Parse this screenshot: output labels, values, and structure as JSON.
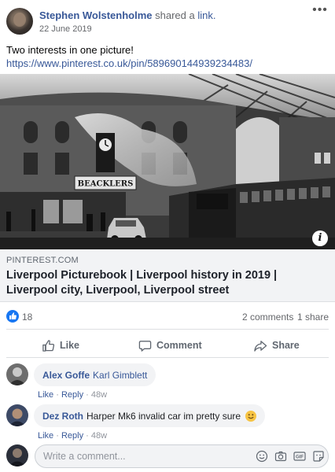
{
  "post": {
    "author": "Stephen Wolstenholme",
    "action_text": "shared a",
    "action_link": "link.",
    "date": "22 June 2019",
    "text": "Two interests in one picture!",
    "url": "https://www.pinterest.co.uk/pin/589690144939234483/",
    "more_label": "•••"
  },
  "image": {
    "sign_text": "BEACKLERS",
    "info_label": "i"
  },
  "link_card": {
    "domain": "PINTEREST.COM",
    "title": "Liverpool Picturebook | Liverpool history in 2019 | Liverpool city, Liverpool, Liverpool street"
  },
  "stats": {
    "likes": "18",
    "comments": "2 comments",
    "shares": "1 share"
  },
  "actions": {
    "like": "Like",
    "comment": "Comment",
    "share": "Share"
  },
  "comments": [
    {
      "author": "Alex Goffe",
      "mention": "Karl Gimblett",
      "text": "",
      "like": "Like",
      "reply": "Reply",
      "time": "48w"
    },
    {
      "author": "Dez Roth",
      "mention": "",
      "text": "Harper Mk6 invalid car im pretty sure",
      "like": "Like",
      "reply": "Reply",
      "time": "48w"
    }
  ],
  "composer": {
    "placeholder": "Write a comment..."
  },
  "colors": {
    "link_blue": "#385898",
    "like_blue": "#1877f2",
    "card_bg": "#f2f3f5"
  }
}
